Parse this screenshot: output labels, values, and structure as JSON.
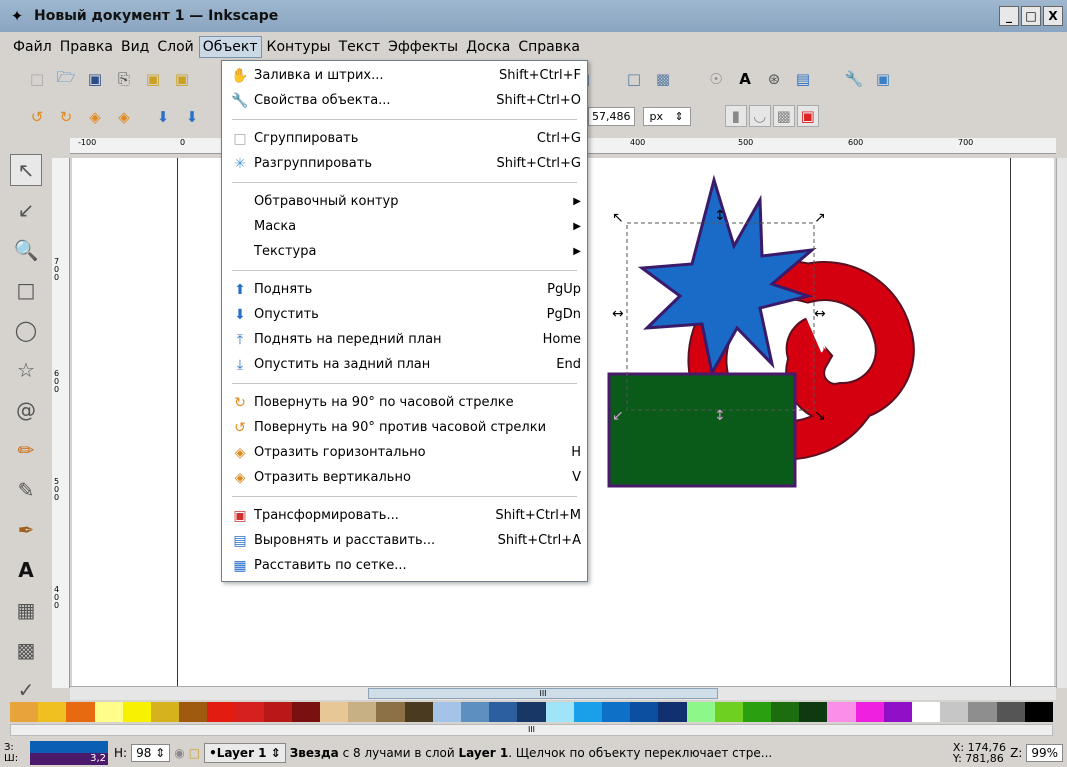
{
  "window": {
    "title": "Новый документ 1 — Inkscape",
    "buttons": [
      "_",
      "□",
      "X"
    ]
  },
  "menubar": [
    "Файл",
    "Правка",
    "Вид",
    "Слой",
    "Объект",
    "Контуры",
    "Текст",
    "Эффекты",
    "Доска",
    "Справка"
  ],
  "active_menu": "Объект",
  "toolbar2": {
    "coord_value": "57,486",
    "unit": "px"
  },
  "ruler": {
    "top": [
      "-100",
      "0",
      "400",
      "500",
      "600",
      "700"
    ],
    "left": [
      "700",
      "600",
      "500",
      "400"
    ]
  },
  "menu": {
    "items": [
      {
        "label": "Заливка и штрих...",
        "shortcut": "Shift+Ctrl+F",
        "icon": "fill-stroke-icon"
      },
      {
        "label": "Свойства объекта...",
        "shortcut": "Shift+Ctrl+O",
        "icon": "wrench-icon"
      },
      {
        "label": "Сгруппировать",
        "shortcut": "Ctrl+G",
        "icon": "group-icon"
      },
      {
        "label": "Разгруппировать",
        "shortcut": "Shift+Ctrl+G",
        "icon": "ungroup-icon"
      },
      {
        "label": "Обтравочный контур",
        "submenu": true
      },
      {
        "label": "Маска",
        "submenu": true
      },
      {
        "label": "Текстура",
        "submenu": true
      },
      {
        "label": "Поднять",
        "shortcut": "PgUp",
        "icon": "raise-icon"
      },
      {
        "label": "Опустить",
        "shortcut": "PgDn",
        "icon": "lower-icon"
      },
      {
        "label": "Поднять на передний план",
        "shortcut": "Home",
        "icon": "raise-top-icon"
      },
      {
        "label": "Опустить на задний план",
        "shortcut": "End",
        "icon": "lower-bottom-icon"
      },
      {
        "label": "Повернуть на 90° по часовой стрелке",
        "icon": "rotate-cw-icon"
      },
      {
        "label": "Повернуть на 90° против часовой стрелки",
        "icon": "rotate-ccw-icon"
      },
      {
        "label": "Отразить горизонтально",
        "shortcut": "H",
        "icon": "flip-h-icon"
      },
      {
        "label": "Отразить вертикально",
        "shortcut": "V",
        "icon": "flip-v-icon"
      },
      {
        "label": "Трансформировать...",
        "shortcut": "Shift+Ctrl+M",
        "icon": "transform-icon"
      },
      {
        "label": "Выровнять и расставить...",
        "shortcut": "Shift+Ctrl+A",
        "icon": "align-icon"
      },
      {
        "label": "Расставить по сетке...",
        "icon": "grid-arrange-icon"
      }
    ]
  },
  "palette": [
    "#e8a33a",
    "#f0c020",
    "#e86a10",
    "#fffe8a",
    "#f7f300",
    "#d6b21d",
    "#a05a10",
    "#e21c10",
    "#d62020",
    "#b81818",
    "#7a1010",
    "#e8c797",
    "#c6b084",
    "#8d7146",
    "#4a3a20",
    "#a3c3e8",
    "#5d8fc0",
    "#2b5f9e",
    "#183766",
    "#a0e4f9",
    "#1aa0e8",
    "#0f70c8",
    "#0a4fa0",
    "#103070",
    "#8ef78a",
    "#6ed020",
    "#2a9f10",
    "#1b6d10",
    "#0f3a10",
    "#fb8ee8",
    "#f020e0",
    "#9010c8",
    "#ffffff",
    "#c6c6c6",
    "#8e8e8e",
    "#555555",
    "#000000"
  ],
  "statusbar": {
    "fs_labels": [
      "З:",
      "Ш:"
    ],
    "stroke_width": "3,2",
    "opacity_label": "Н:",
    "opacity_value": "98",
    "layer": "•Layer 1",
    "message_bold": "Звезда",
    "message_rest": " с 8 лучами в слой ",
    "message_layer": "Layer 1",
    "message_tail": ". Щелчок по объекту переключает стре...",
    "coords": "X: 174,76\nY: 781,86",
    "zoom_label": "Z:",
    "zoom": "99%"
  },
  "scrollbar_grip": "III"
}
